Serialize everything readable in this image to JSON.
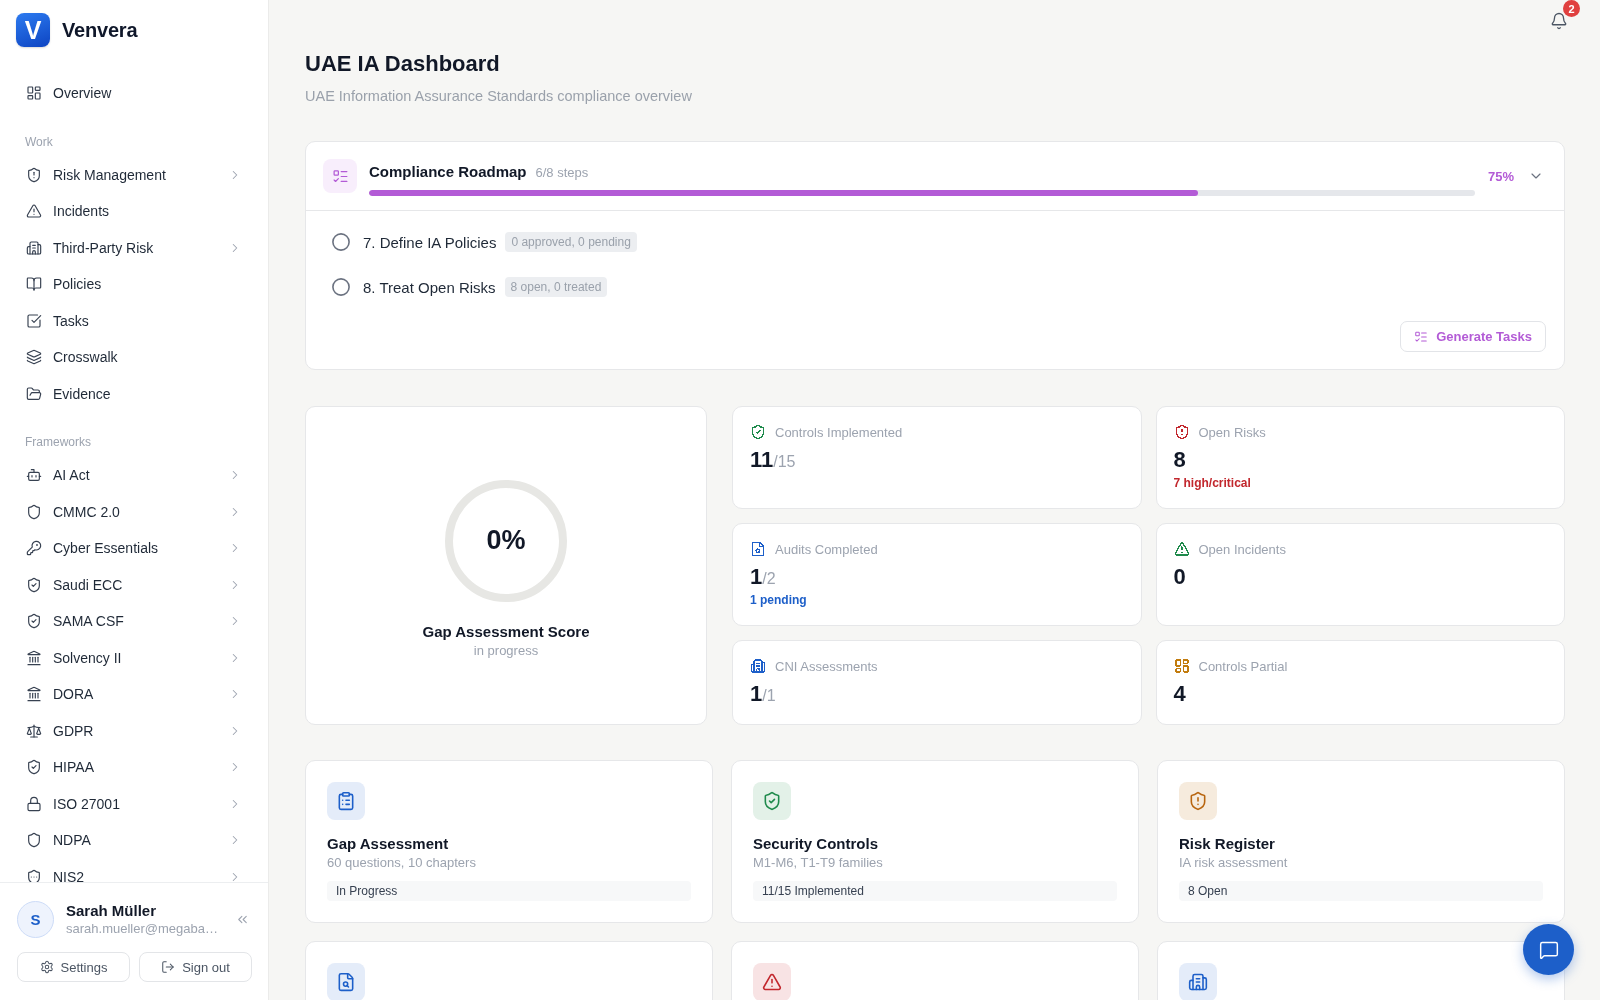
{
  "brand": {
    "mark": "V",
    "name": "Venvera"
  },
  "sidebar": {
    "overview": {
      "label": "Overview"
    },
    "sections": [
      {
        "label": "Work",
        "items": [
          {
            "label": "Risk Management",
            "kind": "group"
          },
          {
            "label": "Incidents",
            "kind": "link"
          },
          {
            "label": "Third-Party Risk",
            "kind": "group"
          },
          {
            "label": "Policies",
            "kind": "link"
          },
          {
            "label": "Tasks",
            "kind": "link"
          },
          {
            "label": "Crosswalk",
            "kind": "link"
          },
          {
            "label": "Evidence",
            "kind": "link"
          }
        ]
      },
      {
        "label": "Frameworks",
        "items": [
          {
            "label": "AI Act",
            "kind": "group"
          },
          {
            "label": "CMMC 2.0",
            "kind": "group"
          },
          {
            "label": "Cyber Essentials",
            "kind": "group"
          },
          {
            "label": "Saudi ECC",
            "kind": "group"
          },
          {
            "label": "SAMA CSF",
            "kind": "group"
          },
          {
            "label": "Solvency II",
            "kind": "group"
          },
          {
            "label": "DORA",
            "kind": "group"
          },
          {
            "label": "GDPR",
            "kind": "group"
          },
          {
            "label": "HIPAA",
            "kind": "group"
          },
          {
            "label": "ISO 27001",
            "kind": "group"
          },
          {
            "label": "NDPA",
            "kind": "group"
          },
          {
            "label": "NIS2",
            "kind": "group"
          }
        ]
      }
    ],
    "user": {
      "initial": "S",
      "name": "Sarah Müller",
      "email": "sarah.mueller@megaba…"
    },
    "actions": [
      "Settings",
      "Sign out"
    ]
  },
  "notifications": {
    "count": "2"
  },
  "page": {
    "title": "UAE IA Dashboard",
    "subtitle": "UAE Information Assurance Standards compliance overview"
  },
  "roadmap": {
    "title": "Compliance Roadmap",
    "steps_count": "6/8 steps",
    "level": 0.75,
    "percent": "75%",
    "expanded": true,
    "steps": [
      {
        "label": "7. Define IA Policies",
        "badge": "0 approved, 0 pending",
        "done": false
      },
      {
        "label": "8. Treat Open Risks",
        "badge": "8 open, 0 treated",
        "done": false
      }
    ],
    "action": "Generate Tasks"
  },
  "score": {
    "value": "0%",
    "title": "Gap Assessment Score",
    "status": "in progress"
  },
  "stats": [
    {
      "label": "Controls Implemented",
      "value": "11",
      "total": "/15",
      "color": "#1f8a4c"
    },
    {
      "label": "Open Risks",
      "value": "8",
      "note": "7 high/critical",
      "color": "#c2272d"
    },
    {
      "label": "Audits Completed",
      "value": "1",
      "total": "/2",
      "note": "1 pending",
      "color": "#1d5fc9"
    },
    {
      "label": "Open Incidents",
      "value": "0",
      "color": "#1f8a4c"
    },
    {
      "label": "CNI Assessments",
      "value": "1",
      "total": "/1",
      "color": "#1d5fc9"
    },
    {
      "label": "Controls Partial",
      "value": "4",
      "color": "#c27c0e"
    }
  ],
  "modules": [
    {
      "kind": "clipboard",
      "title": "Gap Assessment",
      "subtitle": "60 questions, 10 chapters",
      "status": "In Progress"
    },
    {
      "kind": "shield",
      "title": "Security Controls",
      "subtitle": "M1-M6, T1-T9 families",
      "status": "11/15 Implemented"
    },
    {
      "kind": "alert",
      "title": "Risk Register",
      "subtitle": "IA risk assessment",
      "status": "8 Open"
    },
    {
      "kind": "document"
    },
    {
      "kind": "warning"
    },
    {
      "kind": "building"
    }
  ]
}
